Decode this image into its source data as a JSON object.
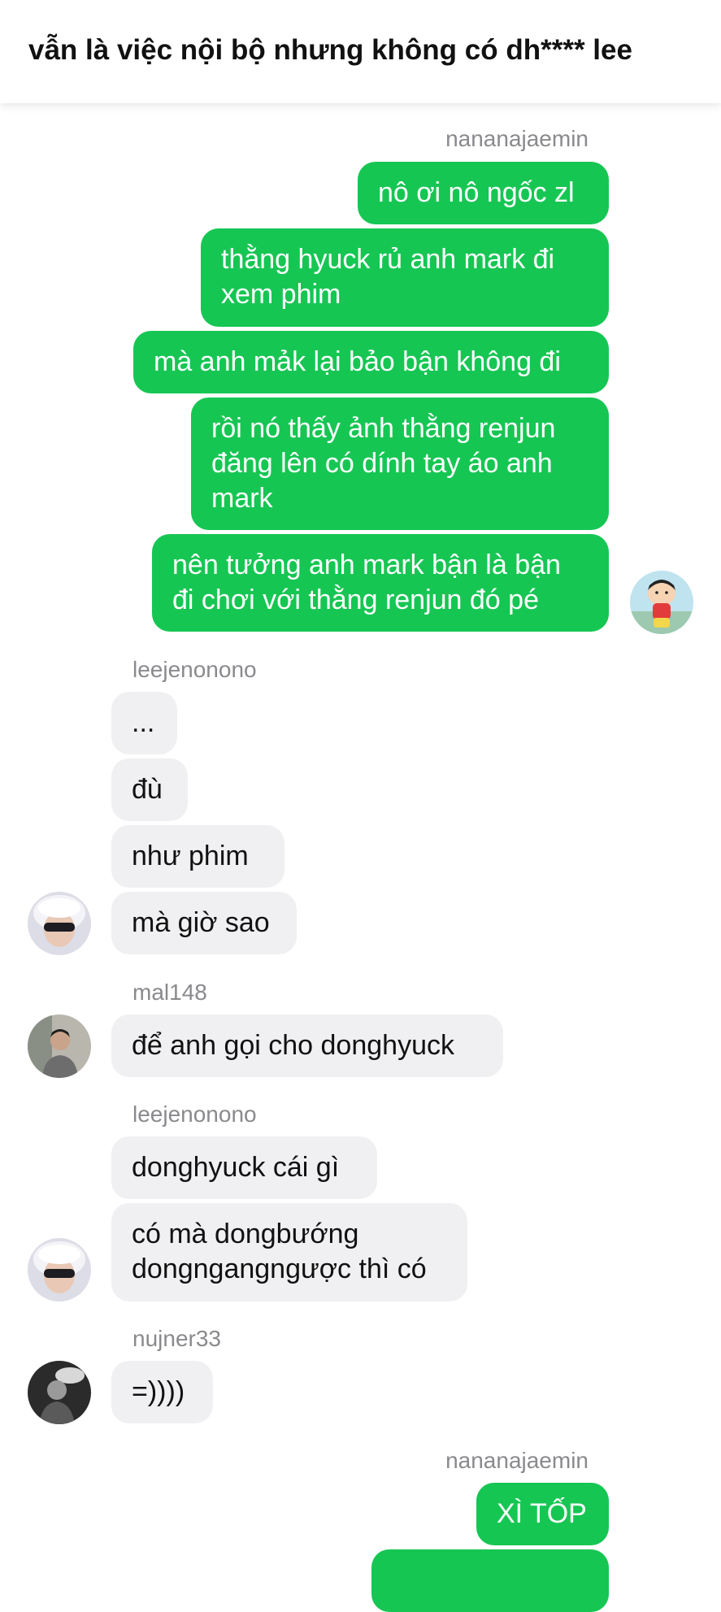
{
  "header": {
    "title": "vẫn là việc nội bộ nhưng không có dh**** lee"
  },
  "groups": [
    {
      "sender": "nananajaemin",
      "avatar_icon": "cartoon-boy-avatar-icon",
      "messages": [
        "nô ơi nô ngốc zl",
        "thằng hyuck rủ anh mark đi\nxem phim",
        "mà anh mảk lại bảo bận không đi",
        "rồi nó thấy ảnh thằng renjun\nđăng lên có dính tay áo anh\nmark",
        "nên tưởng anh mark bận là bận\nđi chơi với thằng renjun đó pé"
      ]
    },
    {
      "sender": "leejenonono",
      "avatar_icon": "white-hair-masked-avatar-icon",
      "messages": [
        "...",
        "đù",
        "như phim",
        "mà giờ sao"
      ]
    },
    {
      "sender": "mal148",
      "avatar_icon": "person-photo-avatar-icon",
      "messages": [
        "để anh gọi cho donghyuck"
      ]
    },
    {
      "sender": "leejenonono",
      "avatar_icon": "white-hair-masked-avatar-icon",
      "messages": [
        "donghyuck cái gì",
        "có mà dongbướng\ndongngangngược thì có"
      ]
    },
    {
      "sender": "nujner33",
      "avatar_icon": "monochrome-photo-avatar-icon",
      "messages": [
        "=))))"
      ]
    },
    {
      "sender": "nananajaemin",
      "avatar_icon": "cartoon-boy-avatar-icon",
      "messages": [
        "XÌ TỐP"
      ]
    }
  ],
  "colors": {
    "outgoing_bubble": "#16c653",
    "incoming_bubble": "#f0f0f2",
    "sender_name": "#8a8a8e"
  }
}
